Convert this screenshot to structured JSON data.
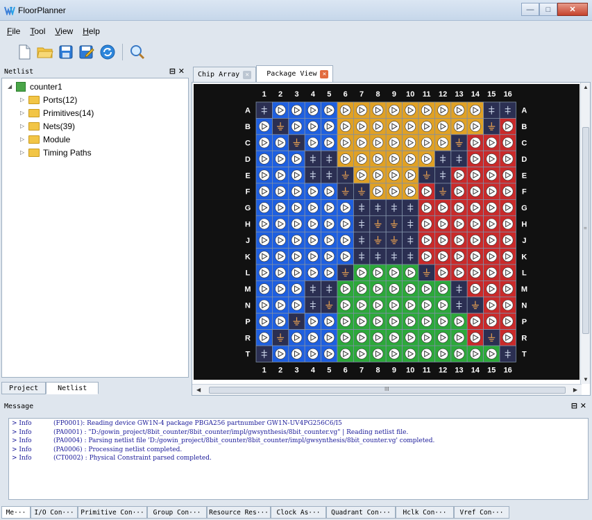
{
  "window": {
    "title": "FloorPlanner",
    "controls": [
      "minimize",
      "maximize",
      "close"
    ]
  },
  "menubar": {
    "items": [
      "File",
      "Tool",
      "View",
      "Help"
    ],
    "mnemonics": [
      "F",
      "T",
      "V",
      "H"
    ]
  },
  "toolbar": {
    "icons": [
      "new-file-icon",
      "open-folder-icon",
      "save-icon",
      "save-as-icon",
      "refresh-icon",
      "search-icon"
    ]
  },
  "netlist": {
    "title": "Netlist",
    "root": "counter1",
    "items": [
      "Ports(12)",
      "Primitives(14)",
      "Nets(39)",
      "Module",
      "Timing Paths"
    ],
    "tabs": [
      "Project",
      "Netlist"
    ],
    "active_tab": "Netlist"
  },
  "editor": {
    "tabs": [
      "Chip Array",
      "Package View"
    ],
    "active_tab": "Package View"
  },
  "package": {
    "cols": [
      "1",
      "2",
      "3",
      "4",
      "5",
      "6",
      "7",
      "8",
      "9",
      "10",
      "11",
      "12",
      "13",
      "14",
      "15",
      "16"
    ],
    "rows": [
      "A",
      "B",
      "C",
      "D",
      "E",
      "F",
      "G",
      "H",
      "J",
      "K",
      "L",
      "M",
      "N",
      "P",
      "R",
      "T"
    ],
    "bank_colors": {
      "b": "#1e5fe0",
      "o": "#e0a125",
      "r": "#c92a2a",
      "g": "#2ca83a",
      "p": "#2b2f52"
    },
    "pin_colors": [
      "bbbbbooooooooooob",
      "",
      "",
      "",
      "",
      "",
      "",
      "",
      "",
      "",
      "",
      "",
      "",
      "",
      "",
      ""
    ],
    "grid": [
      "bbbbboooooooooob",
      "bbbbbooooooooorr",
      "bbbbbooooooorrrr",
      "bbbbbooooooprrrr",
      "bbbbbooooooprrrr",
      "bbbbbooooorrrrrr",
      "bbbbbbpppprrrrrr",
      "bbbbbbpppprrrrrr",
      "bbbbbbpppprrrrrr",
      "bbbbbbpppprrrrrr",
      "bbbbbggggggrrrrr",
      "bbbbbgggggggprrr",
      "bbbbbgggggggprrr",
      "bbbbbggggggggrrr",
      "bbbbbggggggggrrr",
      "bbbbbggggggggggr"
    ],
    "symbols": [
      "vooooooooooooovv",
      "ogoooooooooooogo",
      "oogooooooooogooo",
      "ooovvoooooovvooo",
      "ooovvgoooogvoooo",
      "oooooggoooogoooo",
      "oooooovvvvoooooo",
      "oooooovggvoooooo",
      "oooooovggvoooooo",
      "oooooovvvvoooooo",
      "ooooogoooogooooo",
      "ooovvooooooovooo",
      "ooovgooooooovgoo",
      "oogooooooooooooo",
      "ogoooooooooooogo",
      "voooooooooooooov"
    ]
  },
  "messages": {
    "title": "Message",
    "lines": [
      {
        "level": "> Info",
        "text": "(FP0001): Reading device GW1N-4 package PBGA256 partnumber GW1N-UV4PG256C6/I5"
      },
      {
        "level": "> Info",
        "text": "(PA0001) : \"D:/gowin_project/8bit_counter/8bit_counter/impl/gwsynthesis/8bit_counter.vg\" | Reading netlist file."
      },
      {
        "level": "> Info",
        "text": "(PA0004) : Parsing netlist file 'D:/gowin_project/8bit_counter/8bit_counter/impl/gwsynthesis/8bit_counter.vg' completed."
      },
      {
        "level": "> Info",
        "text": "(PA0006) : Processing netlist completed."
      },
      {
        "level": "> Info",
        "text": "(CT0002) : Physical Constraint parsed completed."
      }
    ],
    "tabs": [
      "Me···",
      "I/O Con···",
      "Primitive Con···",
      "Group Con···",
      "Resource Res···",
      "Clock As···",
      "Quadrant Con···",
      "Hclk Con···",
      "Vref Con···"
    ]
  },
  "scroll": {
    "h_marker": "III",
    "v_marker": "="
  }
}
